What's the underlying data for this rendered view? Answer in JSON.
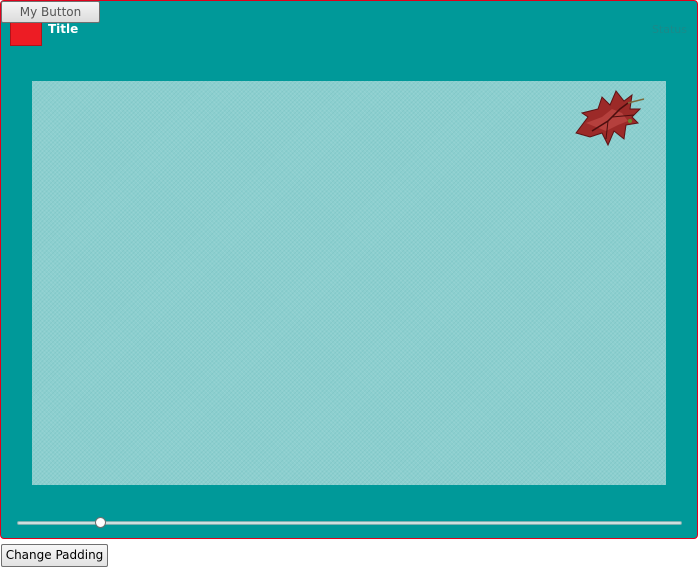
{
  "buttons": {
    "my_button": "My Button",
    "change_padding": "Change Padding"
  },
  "header": {
    "title": "Title",
    "status": "Status"
  },
  "content": {
    "image": "maple-leaf-icon"
  },
  "slider": {
    "value": 0.125
  },
  "colors": {
    "frame_border": "#e0001b",
    "frame_background": "#009999",
    "content_background": "#8ccfcf",
    "square": "#ed1c24"
  }
}
